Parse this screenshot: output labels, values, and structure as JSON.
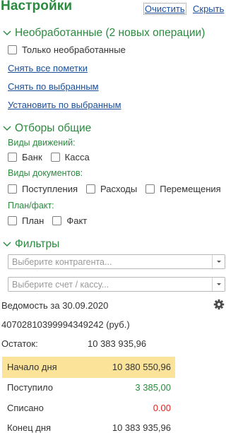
{
  "header": {
    "title": "Настройки",
    "clear_label": "Очистить",
    "hide_label": "Скрыть"
  },
  "unprocessed": {
    "title": "Необработанные (2 новых операции)",
    "only_unprocessed_label": "Только необработанные",
    "links": [
      "Снять все пометки",
      "Снять по выбранным",
      "Установить по выбранным"
    ]
  },
  "filters_common": {
    "title": "Отборы общие",
    "movement_types": {
      "label": "Виды движений:",
      "options": [
        "Банк",
        "Касса"
      ]
    },
    "document_types": {
      "label": "Виды документов:",
      "options": [
        "Поступления",
        "Расходы",
        "Перемещения"
      ]
    },
    "plan_fact": {
      "label": "План/факт:",
      "options": [
        "План",
        "Факт"
      ]
    }
  },
  "filters": {
    "title": "Фильтры",
    "counterparty_placeholder": "Выберите контрагента...",
    "account_placeholder": "Выберите счет / кассу..."
  },
  "statement": {
    "title": "Ведомость за 30.09.2020",
    "account": "40702810399994349242 (руб.)",
    "balance_label": "Остаток:",
    "balance_value": "10 383 935,96",
    "rows": [
      {
        "label": "Начало дня",
        "value": "10 380 550,96",
        "color": "#333333"
      },
      {
        "label": "Поступило",
        "value": "3 385,00",
        "color": "#2a8a3e"
      },
      {
        "label": "Списано",
        "value": "0.00",
        "color": "#e01f1f"
      },
      {
        "label": "Конец дня",
        "value": "10 383 935,96",
        "color": "#333333"
      }
    ]
  },
  "colors": {
    "accent_green": "#2a8a3e",
    "link_blue": "#1a4f9c",
    "highlight": "#fbe49a"
  },
  "icons": [
    "chevron-down-icon",
    "dropdown-arrow-icon",
    "gear-icon"
  ]
}
